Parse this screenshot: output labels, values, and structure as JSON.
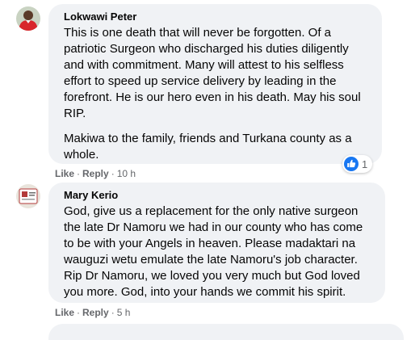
{
  "comments": [
    {
      "author": "Lokwawi Peter",
      "paragraphs": [
        "This is one death that will never be forgotten. Of a\npatriotic Surgeon who discharged his duties diligently\nand with commitment. Many will attest to his selfless\neffort to speed up service delivery by leading in the\nforefront. He is our hero even in his death. May his soul\nRIP.",
        "Makiwa to the family, friends and Turkana county as a\nwhole."
      ],
      "like_label": "Like",
      "reply_label": "Reply",
      "time": "10 h",
      "reaction_count": "1",
      "avatar_icon": "profile-photo-red-shirt"
    },
    {
      "author": "Mary Kerio",
      "paragraphs": [
        "God, give us a replacement for the only native surgeon\nthe late Dr Namoru we had in our county who has come\nto be with your Angels in heaven. Please madaktari na\nwauguzi wetu emulate the late Namoru's job character.\nRip Dr Namoru, we loved you very much but God loved\nyou more. God, into your hands we commit his spirit."
      ],
      "like_label": "Like",
      "reply_label": "Reply",
      "time": "5 h",
      "avatar_icon": "profile-photo-card"
    }
  ],
  "separator": "·",
  "colors": {
    "bubble": "#f0f2f5",
    "text": "#050505",
    "secondary": "#65676b",
    "like_blue": "#1877f2"
  }
}
